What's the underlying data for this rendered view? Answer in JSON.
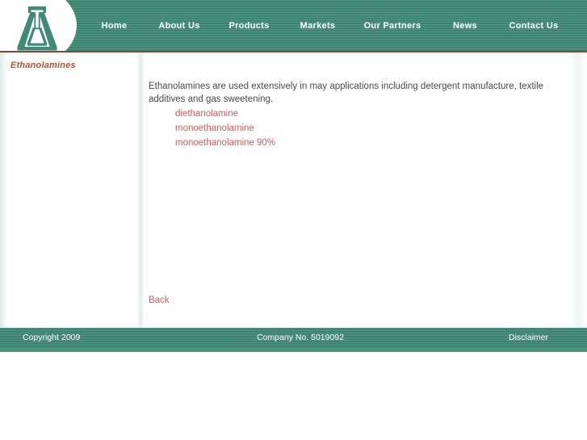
{
  "brand": {
    "logo_icon": "letter-a-monument-logo",
    "header_color": "#3e8a74",
    "accent_rule_color": "#9c3a33",
    "link_color": "#cf5c5c",
    "sidebar_title_color": "#b0522f"
  },
  "nav": {
    "items": [
      {
        "label": "Home",
        "name": "nav-home"
      },
      {
        "label": "About Us",
        "name": "nav-about-us"
      },
      {
        "label": "Products",
        "name": "nav-products"
      },
      {
        "label": "Markets",
        "name": "nav-markets"
      },
      {
        "label": "Our Partners",
        "name": "nav-our-partners"
      },
      {
        "label": "News",
        "name": "nav-news"
      },
      {
        "label": "Contact Us",
        "name": "nav-contact-us"
      }
    ]
  },
  "sidebar": {
    "title": "Ethanolamines"
  },
  "main": {
    "intro": "Ethanolamines are used extensively in may applications including detergent manufacture, textile additives and gas sweetening.",
    "products": [
      "diethanolamine",
      "monoethanolamine",
      "monoethanolamine 90%"
    ],
    "back_label": "Back"
  },
  "footer": {
    "copyright": "Copyright 2009",
    "company_no": "Company No. 5019092",
    "disclaimer": "Disclaimer"
  }
}
